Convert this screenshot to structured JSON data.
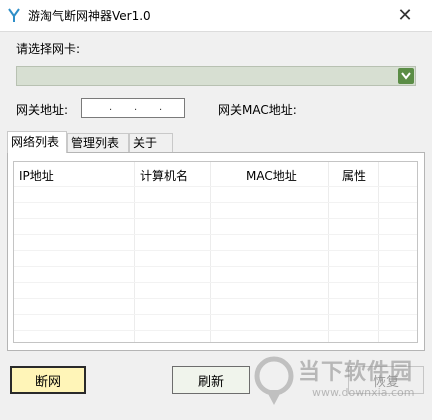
{
  "window": {
    "title": "游淘气断网神器Ver1.0",
    "close_glyph": "✕"
  },
  "adapter": {
    "label": "请选择网卡:",
    "selected": ""
  },
  "gateway": {
    "label": "网关地址:",
    "ip_dots": [
      ".",
      ".",
      "."
    ],
    "mac_label": "网关MAC地址:"
  },
  "tabs": [
    {
      "label": "网络列表",
      "active": true
    },
    {
      "label": "管理列表",
      "active": false
    },
    {
      "label": "关于",
      "active": false
    }
  ],
  "table": {
    "columns": [
      "IP地址",
      "计算机名",
      "MAC地址",
      "属性"
    ],
    "rows": []
  },
  "buttons": {
    "disconnect": "断网",
    "refresh": "刷新",
    "restore": "恢复"
  },
  "watermark": {
    "text": "当下软件园",
    "url": "www.downxia.com"
  },
  "colors": {
    "combo_bg": "#d7dfd2",
    "combo_arrow": "#5b8d46",
    "disconnect_bg": "#fff5b8"
  }
}
